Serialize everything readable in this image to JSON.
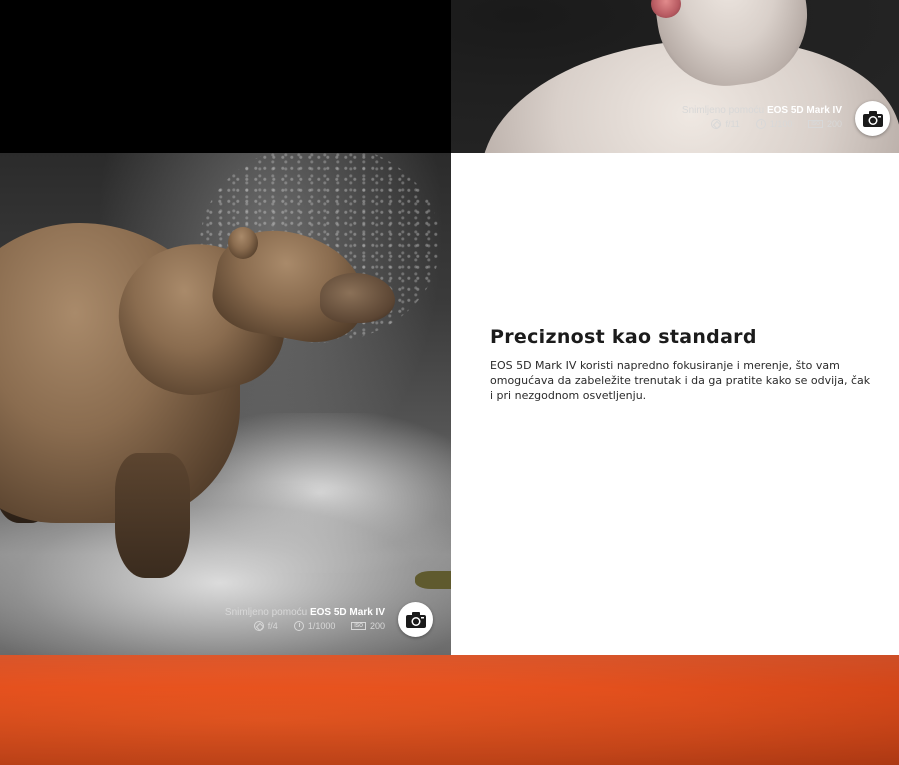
{
  "sections": {
    "portrait": {
      "caption": {
        "prefix": "Snimljeno pomoću",
        "model": "EOS 5D Mark IV",
        "aperture": "f/11",
        "shutter": "1/100",
        "iso": "200",
        "iso_badge": "ISO"
      }
    },
    "bear": {
      "caption": {
        "prefix": "Snimljeno pomoću",
        "model": "EOS 5D Mark IV",
        "aperture": "f/4",
        "shutter": "1/1000",
        "iso": "200",
        "iso_badge": "ISO"
      }
    },
    "feature": {
      "headline": "Preciznost kao standard",
      "body": "EOS 5D Mark IV koristi napredno fokusiranje i merenje, što vam omogućava da zabeležite trenutak i da ga pratite kako se odvija, čak i pri nezgodnom osvetljenju."
    }
  },
  "colors": {
    "accent_orange": "#e4501d",
    "text_dark": "#1b1b1b"
  },
  "icons": [
    "camera-icon",
    "aperture-icon",
    "shutter-icon",
    "iso-icon"
  ]
}
